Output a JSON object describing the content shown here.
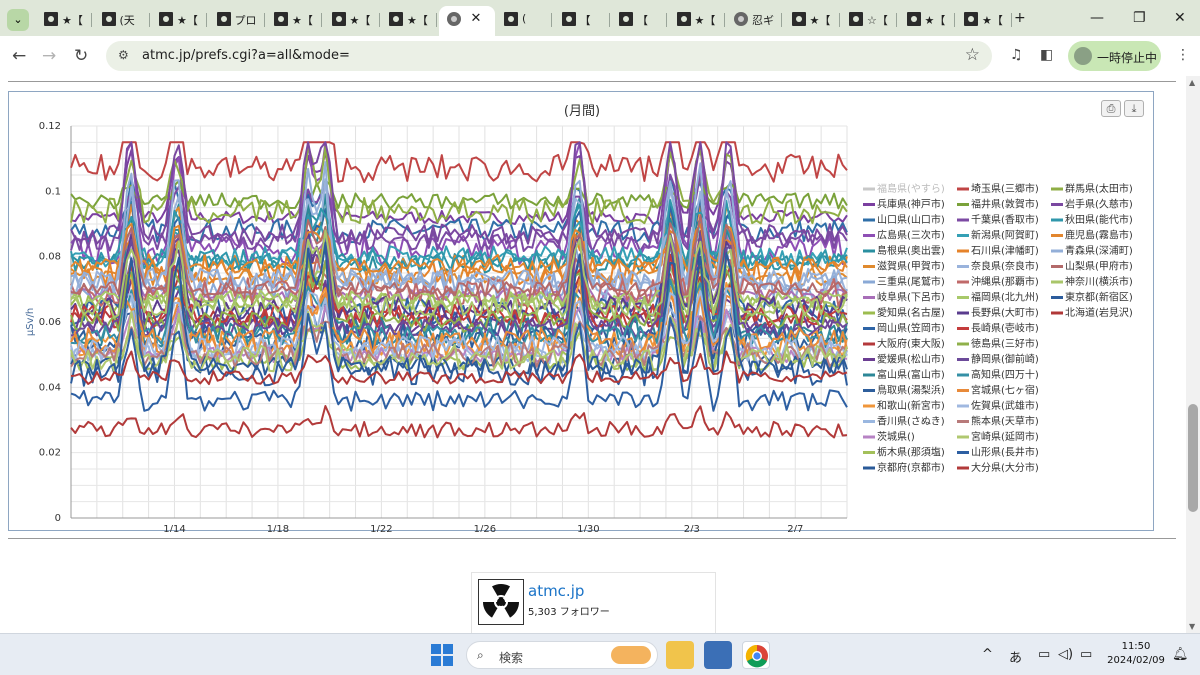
{
  "browser": {
    "tabs": [
      {
        "label": "★【",
        "icon": "site-icon"
      },
      {
        "label": "(天",
        "icon": "site-icon"
      },
      {
        "label": "★【",
        "icon": "site-icon"
      },
      {
        "label": "プロ",
        "icon": "info-icon"
      },
      {
        "label": "★【",
        "icon": "site-icon"
      },
      {
        "label": "★【",
        "icon": "site-icon"
      },
      {
        "label": "★【",
        "icon": "site-icon"
      },
      {
        "label": "",
        "icon": "globe-icon",
        "active": true
      },
      {
        "label": "(",
        "icon": "site-icon"
      },
      {
        "label": "【",
        "icon": "site-icon"
      },
      {
        "label": "【",
        "icon": "site-icon"
      },
      {
        "label": "★【",
        "icon": "site-icon"
      },
      {
        "label": "忍ギ",
        "icon": "globe-icon"
      },
      {
        "label": "★【",
        "icon": "site-icon"
      },
      {
        "label": "☆【",
        "icon": "site-icon"
      },
      {
        "label": "★【",
        "icon": "site-icon"
      },
      {
        "label": "★【",
        "icon": "site-icon"
      }
    ],
    "new_tab": "+",
    "close_tab": "✕",
    "url": "atmc.jp/prefs.cgi?a=all&mode=",
    "pause_label": "一時停止中"
  },
  "chart_data": {
    "type": "line",
    "title": "(月間)",
    "ylabel": "μSv/h",
    "xlabel": "",
    "ylim": [
      0,
      0.12
    ],
    "yticks": [
      "0.12",
      "0.1",
      "0.08",
      "0.06",
      "0.04",
      "0.02",
      "0"
    ],
    "xticks": [
      {
        "day": 4,
        "label": "1/14"
      },
      {
        "day": 8,
        "label": "1/18"
      },
      {
        "day": 12,
        "label": "1/22"
      },
      {
        "day": 16,
        "label": "1/26"
      },
      {
        "day": 20,
        "label": "1/30"
      },
      {
        "day": 24,
        "label": "2/3"
      },
      {
        "day": 28,
        "label": "2/7"
      }
    ],
    "x_start": "1/10",
    "days": 30,
    "grid": true,
    "legend_position": "right",
    "series": [
      {
        "name": "福島県(やすら)",
        "color": "#c8c8c8",
        "base": 0.099,
        "disabled": true
      },
      {
        "name": "兵庫県(神戸市)",
        "color": "#7b3fa0",
        "base": 0.092
      },
      {
        "name": "山口県(山口市)",
        "color": "#2f6fa8",
        "base": 0.088
      },
      {
        "name": "広島県(三次市)",
        "color": "#8e4fb5",
        "base": 0.082
      },
      {
        "name": "島根県(奥出雲)",
        "color": "#2a8fa0",
        "base": 0.078
      },
      {
        "name": "滋賀県(甲賀市)",
        "color": "#e08a2e",
        "base": 0.074
      },
      {
        "name": "三重県(尾鷲市)",
        "color": "#8aa9d6",
        "base": 0.071
      },
      {
        "name": "岐阜県(下呂市)",
        "color": "#a86eb8",
        "base": 0.068
      },
      {
        "name": "愛知県(名古屋)",
        "color": "#9cbc4f",
        "base": 0.066
      },
      {
        "name": "岡山県(笠岡市)",
        "color": "#2e64a6",
        "base": 0.063
      },
      {
        "name": "大阪府(東大阪)",
        "color": "#b4393b",
        "base": 0.061
      },
      {
        "name": "愛媛県(松山市)",
        "color": "#6b3d92",
        "base": 0.059
      },
      {
        "name": "富山県(富山市)",
        "color": "#2c8797",
        "base": 0.057
      },
      {
        "name": "鳥取県(湯梨浜)",
        "color": "#2e5e9c",
        "base": 0.055
      },
      {
        "name": "和歌山(新宮市)",
        "color": "#f0963a",
        "base": 0.053
      },
      {
        "name": "香川県(さぬき)",
        "color": "#9ab7e0",
        "base": 0.051
      },
      {
        "name": "茨城県()",
        "color": "#b783c4",
        "base": 0.05
      },
      {
        "name": "栃木県(那須塩)",
        "color": "#a3c05a",
        "base": 0.048
      },
      {
        "name": "京都府(京都市)",
        "color": "#2a5a98",
        "base": 0.047
      },
      {
        "name": "埼玉県(三郷市)",
        "color": "#c04545",
        "base": 0.107
      },
      {
        "name": "福井県(敦賀市)",
        "color": "#7aa23a",
        "base": 0.097
      },
      {
        "name": "千葉県(香取市)",
        "color": "#7c4aa3",
        "base": 0.085
      },
      {
        "name": "新潟県(阿賀町)",
        "color": "#35a0b5",
        "base": 0.08
      },
      {
        "name": "石川県(津幡町)",
        "color": "#e6832a",
        "base": 0.076
      },
      {
        "name": "奈良県(奈良市)",
        "color": "#9ab3dc",
        "base": 0.072
      },
      {
        "name": "沖縄県(那覇市)",
        "color": "#c06a6a",
        "base": 0.069
      },
      {
        "name": "福岡県(北九州)",
        "color": "#a8c96a",
        "base": 0.067
      },
      {
        "name": "長野県(大町市)",
        "color": "#5a3c8e",
        "base": 0.064
      },
      {
        "name": "長崎県(壱岐市)",
        "color": "#c43c3c",
        "base": 0.062
      },
      {
        "name": "徳島県(三好市)",
        "color": "#8fb04a",
        "base": 0.06
      },
      {
        "name": "静岡県(御前崎)",
        "color": "#6c4a9a",
        "base": 0.058
      },
      {
        "name": "高知県(四万十)",
        "color": "#3590a6",
        "base": 0.056
      },
      {
        "name": "宮城県(七ヶ宿)",
        "color": "#e88a3a",
        "base": 0.054
      },
      {
        "name": "佐賀県(武雄市)",
        "color": "#a0b8e0",
        "base": 0.052
      },
      {
        "name": "熊本県(天草市)",
        "color": "#b87a7a",
        "base": 0.05
      },
      {
        "name": "宮崎県(延岡市)",
        "color": "#b0c870",
        "base": 0.049
      },
      {
        "name": "山形県(長井市)",
        "color": "#2d5fa2",
        "base": 0.036
      },
      {
        "name": "大分県(大分市)",
        "color": "#b23a3a",
        "base": 0.027
      },
      {
        "name": "群馬県(太田市)",
        "color": "#8fae45",
        "base": 0.094
      },
      {
        "name": "岩手県(久慈市)",
        "color": "#7a48a0",
        "base": 0.087
      },
      {
        "name": "秋田県(能代市)",
        "color": "#2f97ab",
        "base": 0.079
      },
      {
        "name": "鹿児島(霧島市)",
        "color": "#e2862e",
        "base": 0.077
      },
      {
        "name": "青森県(深浦町)",
        "color": "#93afd8",
        "base": 0.073
      },
      {
        "name": "山梨県(甲府市)",
        "color": "#b36a6a",
        "base": 0.07
      },
      {
        "name": "神奈川(横浜市)",
        "color": "#a9c66a",
        "base": 0.065
      },
      {
        "name": "東京都(新宿区)",
        "color": "#2c5c9c",
        "base": 0.045
      },
      {
        "name": "北海道(岩見沢)",
        "color": "#b03838",
        "base": 0.043
      }
    ]
  },
  "chart_ui": {
    "print_icon": "print-icon",
    "download_icon": "download-icon"
  },
  "follow": {
    "name": "atmc.jp",
    "followers": "5,303 フォロワー"
  },
  "taskbar": {
    "search_placeholder": "検索",
    "ime": "あ",
    "time": "11:50",
    "date": "2024/02/09"
  }
}
